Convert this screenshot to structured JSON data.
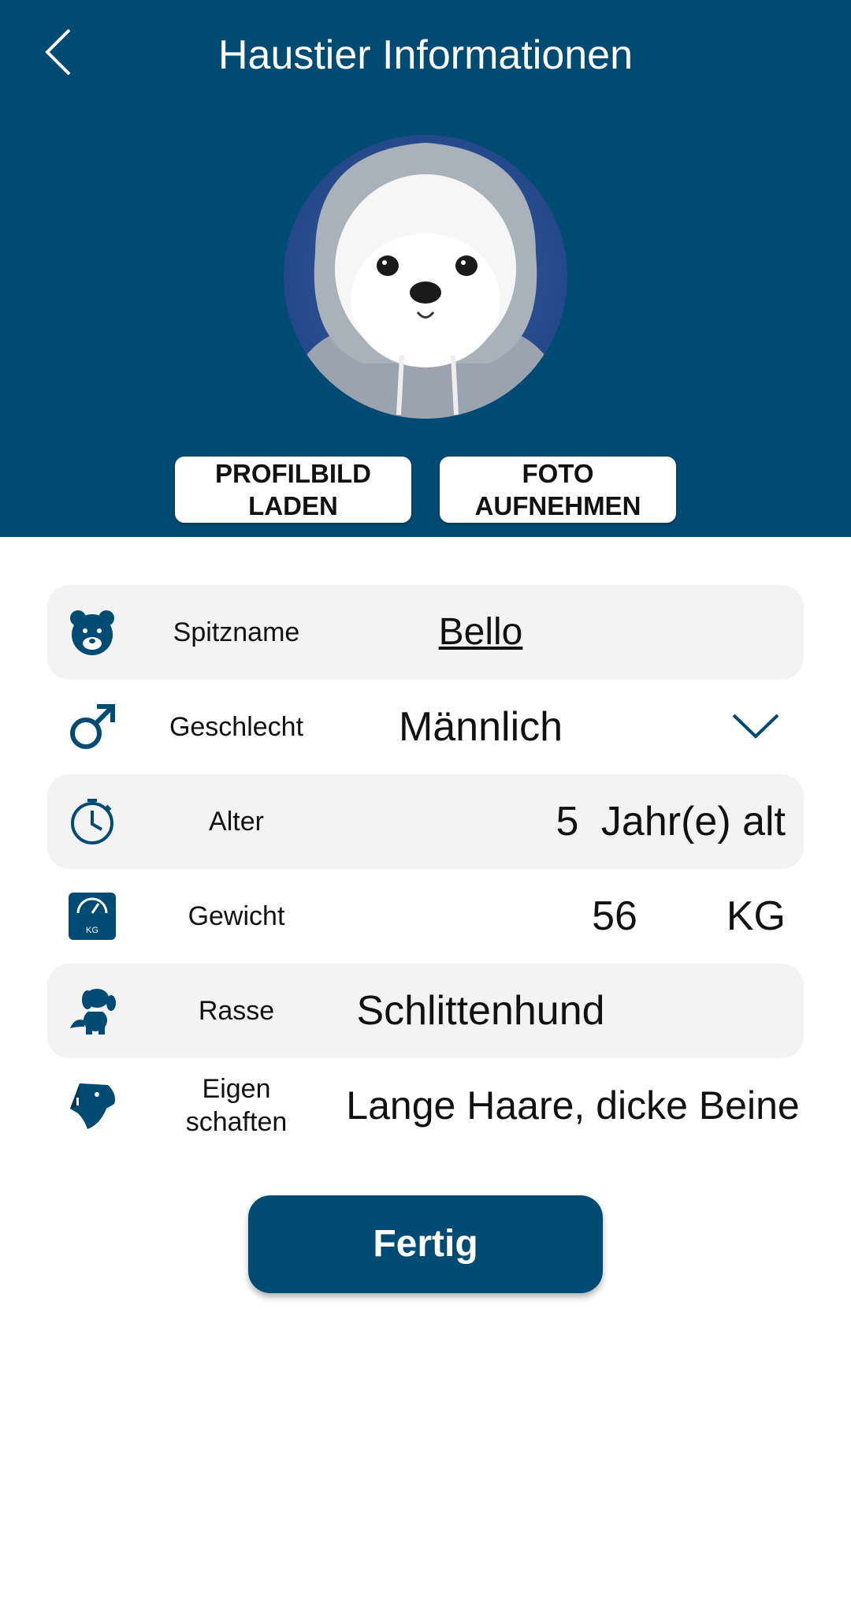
{
  "header": {
    "title": "Haustier Informationen",
    "back_icon": "chevron-left-icon",
    "background_color": "#004b74"
  },
  "avatar": {
    "description_icon": "pet-photo"
  },
  "buttons": {
    "load_profile_picture": "PROFILBILD\nLADEN",
    "take_photo": "FOTO\nAUFNEHMEN",
    "done": "Fertig"
  },
  "form": {
    "nickname": {
      "label": "Spitzname",
      "value": "Bello",
      "icon": "bear-icon"
    },
    "gender": {
      "label": "Geschlecht",
      "value": "Männlich",
      "icon": "male-symbol-icon",
      "dropdown_icon": "chevron-down-icon"
    },
    "age": {
      "label": "Alter",
      "value": "5",
      "unit": "Jahr(e) alt",
      "icon": "stopwatch-icon"
    },
    "weight": {
      "label": "Gewicht",
      "value": "56",
      "unit": "KG",
      "icon": "scale-icon",
      "icon_text": "KG"
    },
    "breed": {
      "label": "Rasse",
      "value": "Schlittenhund",
      "icon": "dog-icon"
    },
    "traits": {
      "label": "Eigen\nschaften",
      "value": "Lange Haare, dicke Beine",
      "icon": "dog-head-icon"
    }
  },
  "colors": {
    "accent": "#004b74",
    "row_shade": "#f3f3f3"
  }
}
